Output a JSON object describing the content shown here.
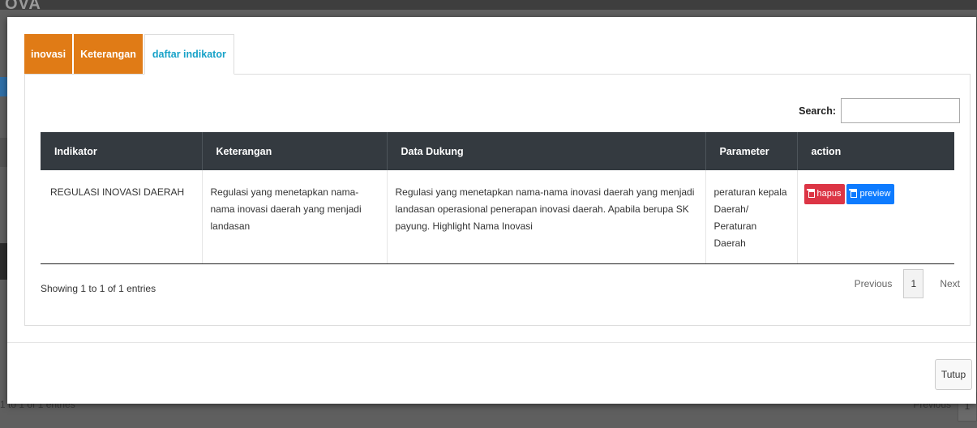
{
  "background": {
    "logo_text": "OVA",
    "footer_info": "1 to 1 of 1 entries",
    "footer_pager": "Previous",
    "page_number": "1"
  },
  "tabs": [
    {
      "label": "inovasi",
      "color": "#e07b16"
    },
    {
      "label": "Keterangan",
      "color": "#e07b16"
    },
    {
      "label": "daftar indikator",
      "color": "#17a2c8",
      "active": true
    }
  ],
  "search": {
    "label": "Search:",
    "value": ""
  },
  "table": {
    "headers": [
      "Indikator",
      "Keterangan",
      "Data Dukung",
      "Parameter",
      "action"
    ],
    "rows": [
      {
        "indikator": "REGULASI INOVASI DAERAH",
        "keterangan": "Regulasi yang menetapkan nama-nama inovasi daerah yang menjadi landasan",
        "data_dukung": "Regulasi yang menetapkan nama-nama inovasi daerah yang menjadi landasan operasional penerapan inovasi daerah. Apabila berupa SK payung. Highlight Nama Inovasi",
        "parameter": "peraturan kepala Daerah/ Peraturan Daerah",
        "actions": {
          "delete_label": "hapus",
          "preview_label": "preview"
        }
      }
    ]
  },
  "info": "Showing 1 to 1 of 1 entries",
  "pagination": {
    "previous": "Previous",
    "current": "1",
    "next": "Next"
  },
  "close_button": "Tutup",
  "colors": {
    "header_dark": "#343a40",
    "danger": "#dc3545",
    "primary": "#0d7bff",
    "tab_orange": "#e07b16",
    "tab_active_text": "#17a2c8"
  }
}
